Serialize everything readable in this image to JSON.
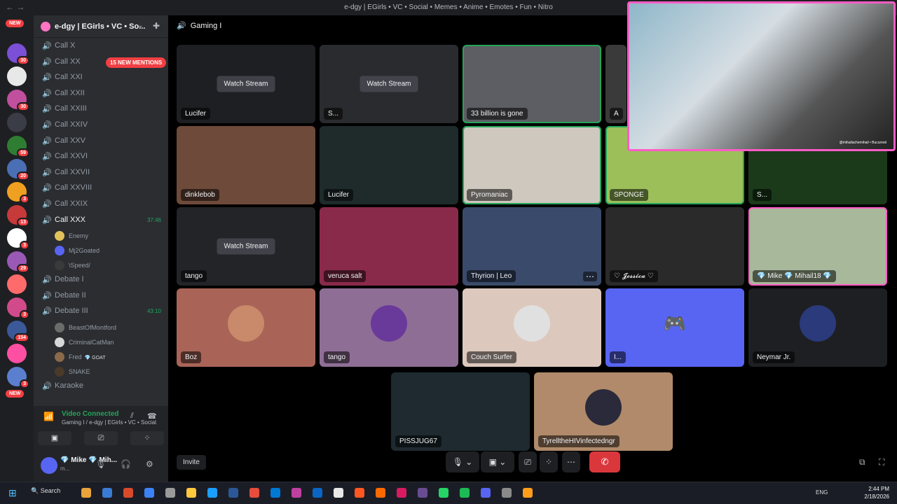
{
  "window": {
    "title": "e-dgy | EGirls • VC • Social • Memes • Anime • Emotes • Fun • Nitro",
    "nav": "← →"
  },
  "rail": {
    "new_top": "NEW",
    "new_bottom": "NEW",
    "servers": [
      {
        "badge": "30",
        "color": "#7b4fd6"
      },
      {
        "badge": "",
        "color": "#e8e8e8"
      },
      {
        "badge": "30",
        "color": "#c04f9e"
      },
      {
        "badge": "",
        "color": "#3a3c46"
      },
      {
        "badge": "59",
        "color": "#2e7d32"
      },
      {
        "badge": "20",
        "color": "#4a6fb5"
      },
      {
        "badge": "3",
        "color": "#f0a020"
      },
      {
        "badge": "13",
        "color": "#c73a3a"
      },
      {
        "badge": "3",
        "color": "#ffffff"
      },
      {
        "badge": "29",
        "color": "#9b59b6"
      },
      {
        "badge": "",
        "color": "#ff6b6b"
      },
      {
        "badge": "3",
        "color": "#d14a8a"
      },
      {
        "badge": "154",
        "color": "#3b5998"
      },
      {
        "badge": "",
        "color": "#ff4fa3"
      },
      {
        "badge": "3",
        "color": "#5b7fcf"
      }
    ]
  },
  "server": {
    "name": "e-dgy | EGirls • VC • So...",
    "chevron": "⌄",
    "add_icon": "✚"
  },
  "sidebar": {
    "mentions_pill": "15 NEW MENTIONS",
    "channels": [
      {
        "label": "Call X",
        "time": ""
      },
      {
        "label": "Call XX",
        "time": ""
      },
      {
        "label": "Call XXI",
        "time": ""
      },
      {
        "label": "Call XXII",
        "time": ""
      },
      {
        "label": "Call XXIII",
        "time": ""
      },
      {
        "label": "Call XXIV",
        "time": ""
      },
      {
        "label": "Call XXV",
        "time": ""
      },
      {
        "label": "Call XXVI",
        "time": ""
      },
      {
        "label": "Call XXVII",
        "time": ""
      },
      {
        "label": "Call XXVIII",
        "time": ""
      },
      {
        "label": "Call XXIX",
        "time": ""
      },
      {
        "label": "Call XXX",
        "time": "37:46"
      }
    ],
    "call_xxx_members": [
      {
        "name": "Enemy",
        "color": "#e0c15a"
      },
      {
        "name": "Mj2Goated",
        "color": "#5865f2"
      },
      {
        "name": "\\Speed/",
        "color": "#3a3a3a"
      }
    ],
    "debates": [
      {
        "label": "Debate I",
        "time": ""
      },
      {
        "label": "Debate II",
        "time": ""
      },
      {
        "label": "Debate III",
        "time": "43:10"
      }
    ],
    "debate_members": [
      {
        "name": "BeastOfMontford",
        "color": "#6b6b6b",
        "badge": ""
      },
      {
        "name": "CriminalCatMan",
        "color": "#d7d7d7",
        "badge": ""
      },
      {
        "name": "Fred",
        "color": "#8a6a4a",
        "badge": "💎 GOAT"
      },
      {
        "name": "SNAKE",
        "color": "#4a3a2a",
        "badge": ""
      }
    ],
    "karaoke": "Karaoke"
  },
  "voice": {
    "status": "Video Connected",
    "channel": "Gaming I / e-dgy | EGirls • VC • Social...",
    "buttons": [
      "▣",
      "⎚",
      "⁘"
    ]
  },
  "user": {
    "name": "💎 Mike 💎 Mih...",
    "status": "m..."
  },
  "main": {
    "channel_title": "Gaming I",
    "tiles": [
      {
        "name": "Lucifer",
        "watch": "Watch Stream",
        "bg": "#1e1f22",
        "style": ""
      },
      {
        "name": "S...",
        "watch": "Watch Stream",
        "bg": "#2a2b2e",
        "style": ""
      },
      {
        "name": "33 billion is gone",
        "watch": "",
        "bg": "#5d5e64",
        "style": "speaking"
      },
      {
        "name": "A",
        "watch": "",
        "bg": "#3a3a3a",
        "style": ""
      },
      {
        "name": "dinklebob",
        "watch": "",
        "bg": "#6e4a3a",
        "style": ""
      },
      {
        "name": "Lucifer",
        "watch": "",
        "bg": "#1f2a2a",
        "style": ""
      },
      {
        "name": "Pyromaniac",
        "watch": "",
        "bg": "#cfc8be",
        "style": "speaking"
      },
      {
        "name": "SPONGE",
        "watch": "",
        "bg": "#9cbf5a",
        "style": "speaking"
      },
      {
        "name": "S...",
        "watch": "",
        "bg": "#1a3a1a",
        "style": ""
      },
      {
        "name": "tango",
        "watch": "Watch Stream",
        "bg": "#232427",
        "style": ""
      },
      {
        "name": "veruca salt",
        "watch": "",
        "bg": "#8a2a4a",
        "style": ""
      },
      {
        "name": "Thyrion | Leo",
        "watch": "",
        "bg": "#3a4a6a",
        "style": ""
      },
      {
        "name": "♡ 𝓙𝓮𝓼𝓼𝓲𝓬𝓪 ♡",
        "watch": "",
        "bg": "#2a2a2a",
        "style": ""
      },
      {
        "name": "💎 Mike 💎 Mihail18 💎",
        "watch": "",
        "bg": "#a8b89a",
        "style": "pink"
      },
      {
        "name": "Boz",
        "watch": "",
        "bg": "#a96457",
        "style": "",
        "avatar": "#c88a6a"
      },
      {
        "name": "tango",
        "watch": "",
        "bg": "#8f6e96",
        "style": "",
        "avatar": "#6a3a9a"
      },
      {
        "name": "Couch Surfer",
        "watch": "",
        "bg": "#ddc8bd",
        "style": "",
        "avatar": "#e0e0e0"
      },
      {
        "name": "I...",
        "watch": "",
        "bg": "#5865f2",
        "style": "",
        "avatar": ""
      },
      {
        "name": "Neymar Jr.",
        "watch": "",
        "bg": "#1e1f22",
        "style": "",
        "avatar": "#2a3a7a"
      },
      {
        "name": "PISSJUG67",
        "watch": "",
        "bg": "#1e2a30",
        "style": "",
        "avatar": ""
      },
      {
        "name": "TyrelltheHIVinfectedngr",
        "watch": "",
        "bg": "#b08a6a",
        "style": "",
        "avatar": "#2a2a3a"
      }
    ],
    "overlay_caption": "@mihailachemihail • Bucuresti"
  },
  "controls": {
    "invite": "Invite",
    "mic": "🎙 ⌄",
    "camera": "▣ ⌄",
    "share": "⎚",
    "activities": "⁘",
    "more": "⋯",
    "hangup": "✆",
    "popout": "⧉",
    "fullscreen": "⛶"
  },
  "taskbar": {
    "start": "⊞",
    "search": "🔍 Search",
    "lang": "ENG",
    "time": "2:44 PM",
    "date": "2/18/2026",
    "apps": [
      "#e8a33a",
      "#3a7bd5",
      "#d94a2a",
      "#3b82f6",
      "#9a9a9a",
      "#ffc83d",
      "#1a9fff",
      "#2b5797",
      "#e74c3c",
      "#0078d4",
      "#c040a0",
      "#0a66c2",
      "#e8e8e8",
      "#ff5722",
      "#ff6a00",
      "#d81b60",
      "#6a4c93",
      "#25d366",
      "#1db954",
      "#5865f2",
      "#8a8a8a",
      "#ff9e1b"
    ]
  }
}
